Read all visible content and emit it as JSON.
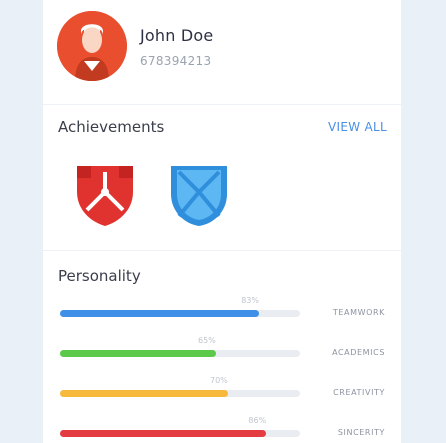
{
  "profile": {
    "name": "John Doe",
    "phone": "678394213"
  },
  "achievements": {
    "title": "Achievements",
    "view_all": "VIEW ALL",
    "badges": [
      {
        "icon": "red-shield-badge-icon",
        "color": "#e0332f"
      },
      {
        "icon": "blue-shield-badge-icon",
        "color": "#3aa0e8"
      }
    ]
  },
  "personality": {
    "title": "Personality",
    "traits": [
      {
        "label": "TEAMWORK",
        "percent_label": "83%",
        "value": 0.83,
        "color": "#3d8fe8"
      },
      {
        "label": "ACADEMICS",
        "percent_label": "65%",
        "value": 0.65,
        "color": "#5cc94a"
      },
      {
        "label": "CREATIVITY",
        "percent_label": "70%",
        "value": 0.7,
        "color": "#f6b93b"
      },
      {
        "label": "SINCERITY",
        "percent_label": "86%",
        "value": 0.86,
        "color": "#e43c43"
      }
    ]
  }
}
